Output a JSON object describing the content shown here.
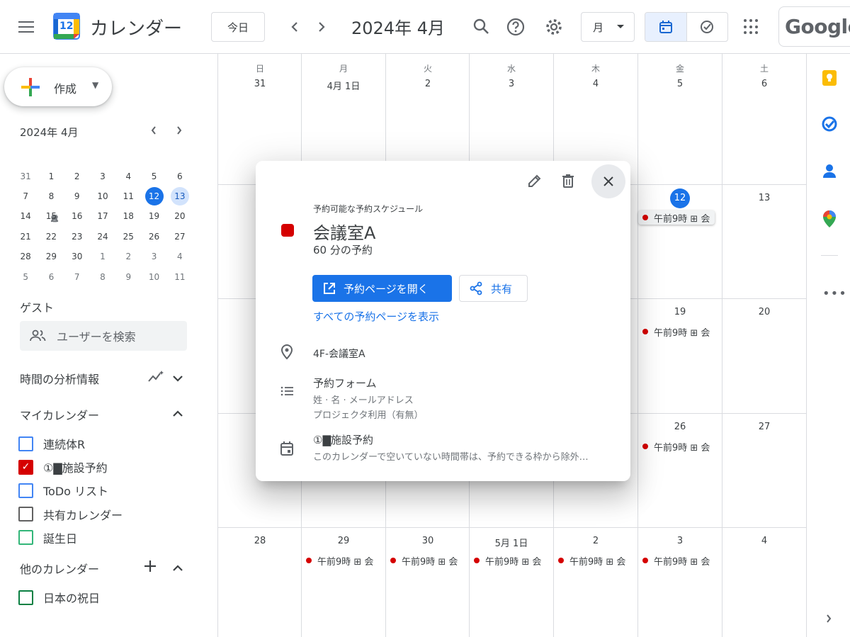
{
  "header": {
    "app_title": "カレンダー",
    "logo_day": "12",
    "today_label": "今日",
    "current_month": "2024年 4月",
    "view_label": "月",
    "google_label": "Google"
  },
  "sidebar": {
    "create_label": "作成",
    "mini_title": "2024年 4月",
    "mini_dow": [
      "日",
      "月",
      "火",
      "水",
      "木",
      "金",
      "土"
    ],
    "mini_weeks": [
      [
        "31",
        "1",
        "2",
        "3",
        "4",
        "5",
        "6"
      ],
      [
        "7",
        "8",
        "9",
        "10",
        "11",
        "12",
        "13"
      ],
      [
        "14",
        "15",
        "16",
        "17",
        "18",
        "19",
        "20"
      ],
      [
        "21",
        "22",
        "23",
        "24",
        "25",
        "26",
        "27"
      ],
      [
        "28",
        "29",
        "30",
        "1",
        "2",
        "3",
        "4"
      ],
      [
        "5",
        "6",
        "7",
        "8",
        "9",
        "10",
        "11"
      ]
    ],
    "guest_label": "ゲスト",
    "search_placeholder": "ユーザーを検索",
    "insights_label": "時間の分析情報",
    "my_calendars_label": "マイカレンダー",
    "my_calendars": [
      {
        "label": "連続体R",
        "color": "#4285f4",
        "checked": false
      },
      {
        "label": "①▇施設予約",
        "color": "#d50000",
        "checked": true
      },
      {
        "label": "ToDo リスト",
        "color": "#4285f4",
        "checked": false
      },
      {
        "label": "共有カレンダー",
        "color": "#616161",
        "checked": false
      },
      {
        "label": "誕生日",
        "color": "#33b679",
        "checked": false
      }
    ],
    "other_calendars_label": "他のカレンダー",
    "other_calendars": [
      {
        "label": "日本の祝日",
        "color": "#0b8043",
        "checked": false
      }
    ]
  },
  "grid": {
    "dow": [
      "日",
      "月",
      "火",
      "水",
      "木",
      "金",
      "土"
    ],
    "first_row_dates": [
      "31",
      "4月 1日",
      "2",
      "3",
      "4",
      "5",
      "6"
    ],
    "visible_dates": {
      "fri_12": "12",
      "sat_13": "13",
      "fri_19": "19",
      "sat_20": "20",
      "fri_26": "26",
      "sat_27": "27",
      "row5": [
        "28",
        "29",
        "30",
        "5月 1日",
        "2",
        "3",
        "4"
      ]
    },
    "event_label": "午前9時 ⊞ 会"
  },
  "popup": {
    "kicker": "予約可能な予約スケジュール",
    "title": "会議室A",
    "duration": "60 分の予約",
    "open_btn": "予約ページを開く",
    "share_btn": "共有",
    "all_pages_link": "すべての予約ページを表示",
    "location": "4F-会議室A",
    "form_title": "予約フォーム",
    "form_line1": "姓 · 名 · メールアドレス",
    "form_line2": "プロジェクタ利用（有無）",
    "calendar_name": "①▇施設予約",
    "calendar_note": "このカレンダーで空いていない時間帯は、予約できる枠から除外…",
    "color": "#d50000"
  }
}
